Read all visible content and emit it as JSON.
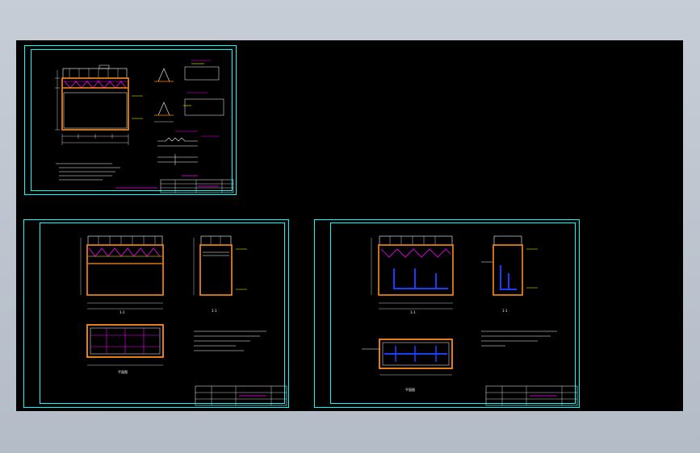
{
  "app": {
    "title": ""
  },
  "viewport": {
    "background": "#000000",
    "frame_color": "#00ffff",
    "drawing_colors": {
      "orange": "#ff8c1a",
      "magenta": "#ff00ff",
      "white": "#ffffff",
      "cyan": "#00ffff",
      "blue": "#1a3cff",
      "yellow": "#ffff00",
      "green": "#33ff66"
    }
  },
  "sheets": [
    {
      "name": "sheet-1",
      "section_label_a": "",
      "section_label_b": ""
    },
    {
      "name": "sheet-2",
      "section_label_a": "1-1",
      "section_label_b": "1-1",
      "plan_label": "平面图"
    },
    {
      "name": "sheet-3",
      "section_label_a": "1-1",
      "section_label_b": "1-1",
      "plan_label": "平面图"
    }
  ]
}
